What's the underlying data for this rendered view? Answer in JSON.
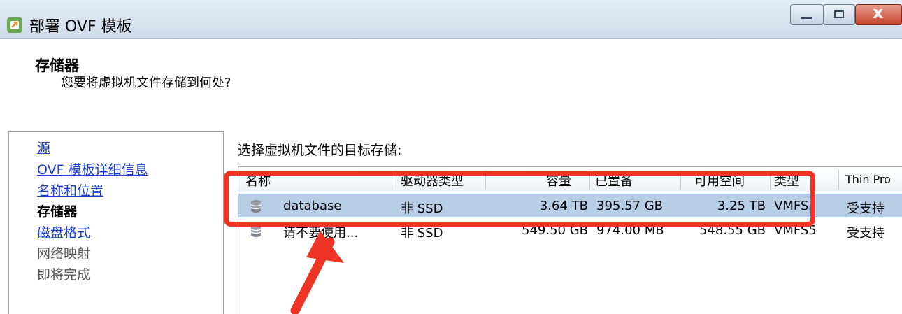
{
  "window": {
    "title": "部署 OVF 模板",
    "icon": "ovf-deploy-icon",
    "controls": {
      "minimize": "—",
      "maximize": "□",
      "close": "x"
    }
  },
  "header": {
    "heading": "存储器",
    "subheading": "您要将虚拟机文件存储到何处?"
  },
  "nav": {
    "items": [
      {
        "label": "源",
        "state": "link"
      },
      {
        "label": "OVF 模板详细信息",
        "state": "link"
      },
      {
        "label": "名称和位置",
        "state": "link"
      },
      {
        "label": "存储器",
        "state": "current"
      },
      {
        "label": "磁盘格式",
        "state": "link"
      },
      {
        "label": "网络映射",
        "state": "disabled"
      },
      {
        "label": "即将完成",
        "state": "disabled"
      }
    ]
  },
  "content": {
    "label": "选择虚拟机文件的目标存储:",
    "columns": [
      "名称",
      "驱动器类型",
      "容量",
      "已置备",
      "可用空间",
      "类型",
      "Thin Pro"
    ],
    "rows": [
      {
        "name": "database",
        "drive_type": "非 SSD",
        "capacity": "3.64 TB",
        "provisioned": "395.57 GB",
        "free": "3.25 TB",
        "type": "VMFS5",
        "thin": "受支持",
        "selected": true
      },
      {
        "name": "请不要使用...",
        "drive_type": "非 SSD",
        "capacity": "549.50 GB",
        "provisioned": "974.00 MB",
        "free": "548.55 GB",
        "type": "VMFS5",
        "thin": "受支持",
        "selected": false
      }
    ]
  },
  "annotation": {
    "box_color": "#ee3424",
    "arrow_color": "#ee3424"
  }
}
